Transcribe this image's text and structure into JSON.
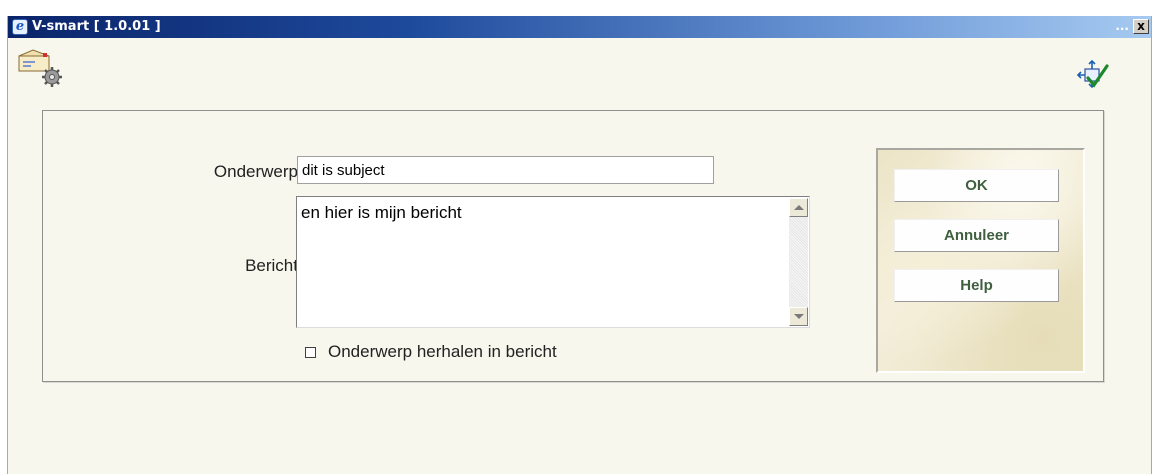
{
  "window": {
    "title": "V-smart [ 1.0.01 ]",
    "dots": "...",
    "close": "x",
    "ie_icon": "e"
  },
  "icons": {
    "app": "mail-settings-icon",
    "confirm": "confirm-checkmark-icon"
  },
  "form": {
    "subject_label": "Onderwerp",
    "subject_value": "dit is subject",
    "message_label": "Bericht",
    "message_value": "en hier is mijn bericht",
    "repeat_subject_label": "Onderwerp herhalen in bericht",
    "repeat_subject_checked": false
  },
  "buttons": {
    "ok": "OK",
    "cancel": "Annuleer",
    "help": "Help"
  },
  "colors": {
    "titlebar": "#0a246a",
    "background": "#f7f7ee",
    "button_text": "#3f5f3f"
  }
}
